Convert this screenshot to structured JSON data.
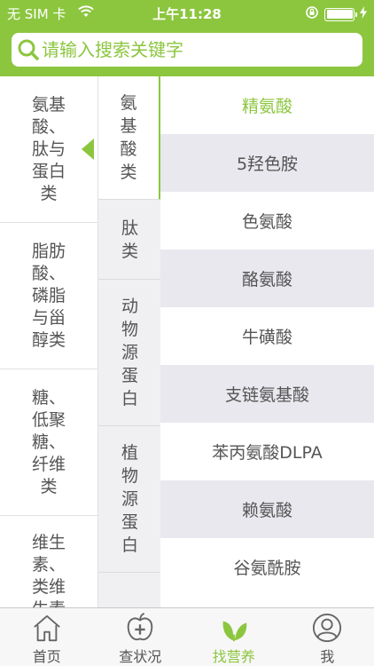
{
  "status_bar": {
    "carrier": "无 SIM 卡",
    "time": "上午11:28"
  },
  "search": {
    "placeholder": "请输入搜索关键字"
  },
  "categories": [
    {
      "label": "氨基酸、肽与蛋白类",
      "selected": true
    },
    {
      "label": "脂肪酸、磷脂与甾醇类",
      "selected": false
    },
    {
      "label": "糖、低聚糖、纤维类",
      "selected": false
    },
    {
      "label": "维生素、类维生素",
      "selected": false
    }
  ],
  "subcategories": [
    {
      "label": "氨基酸类",
      "selected": true
    },
    {
      "label": "肽类",
      "selected": false
    },
    {
      "label": "动物源蛋白",
      "selected": false
    },
    {
      "label": "植物源蛋白",
      "selected": false
    }
  ],
  "items": [
    {
      "label": "精氨酸",
      "selected": true
    },
    {
      "label": "5羟色胺",
      "selected": false
    },
    {
      "label": "色氨酸",
      "selected": false
    },
    {
      "label": "酪氨酸",
      "selected": false
    },
    {
      "label": "牛磺酸",
      "selected": false
    },
    {
      "label": "支链氨基酸",
      "selected": false
    },
    {
      "label": "苯丙氨酸DLPA",
      "selected": false
    },
    {
      "label": "赖氨酸",
      "selected": false
    },
    {
      "label": "谷氨酰胺",
      "selected": false
    }
  ],
  "tabs": [
    {
      "label": "首页",
      "icon": "home-icon",
      "active": false
    },
    {
      "label": "查状况",
      "icon": "apple-plus-icon",
      "active": false
    },
    {
      "label": "找营养",
      "icon": "leaf-icon",
      "active": true
    },
    {
      "label": "我",
      "icon": "user-icon",
      "active": false
    }
  ],
  "colors": {
    "accent": "#8cc63f",
    "text": "#555555",
    "row_alt": "#e8e8ee"
  }
}
